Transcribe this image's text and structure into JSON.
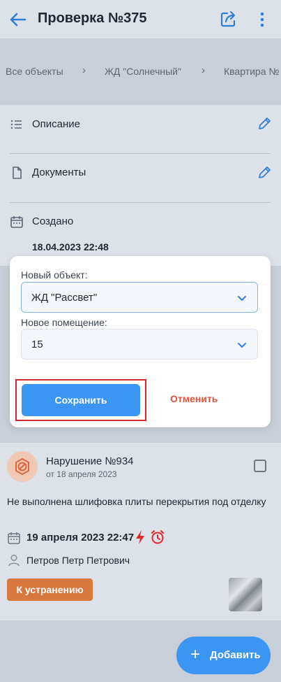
{
  "header": {
    "title": "Проверка №375",
    "back_icon": "arrow-left-icon",
    "share_icon": "share-icon",
    "menu_icon": "more-vertical-icon",
    "accent": "#3b95f3"
  },
  "breadcrumbs": [
    "Все объекты",
    "ЖД \"Солнечный\"",
    "Квартира №"
  ],
  "info": {
    "description_label": "Описание",
    "documents_label": "Документы",
    "created_label": "Создано",
    "created_value": "18.04.2023 22:48"
  },
  "modal": {
    "object_label": "Новый объект:",
    "object_value": "ЖД \"Рассвет\"",
    "room_label": "Новое помещение:",
    "room_value": "15",
    "save_label": "Сохранить",
    "cancel_label": "Отменить"
  },
  "violation": {
    "title": "Нарушение №934",
    "subtitle": "от 18 апреля 2023",
    "description": "Не выполнена шлифовка плиты перекрытия под отделку",
    "deadline": "19 апреля 2023 22:47",
    "person": "Петров Петр Петрович",
    "status": "К устранению",
    "status_color": "#d9773f"
  },
  "fab": {
    "plus": "+",
    "label": "Добавить"
  }
}
